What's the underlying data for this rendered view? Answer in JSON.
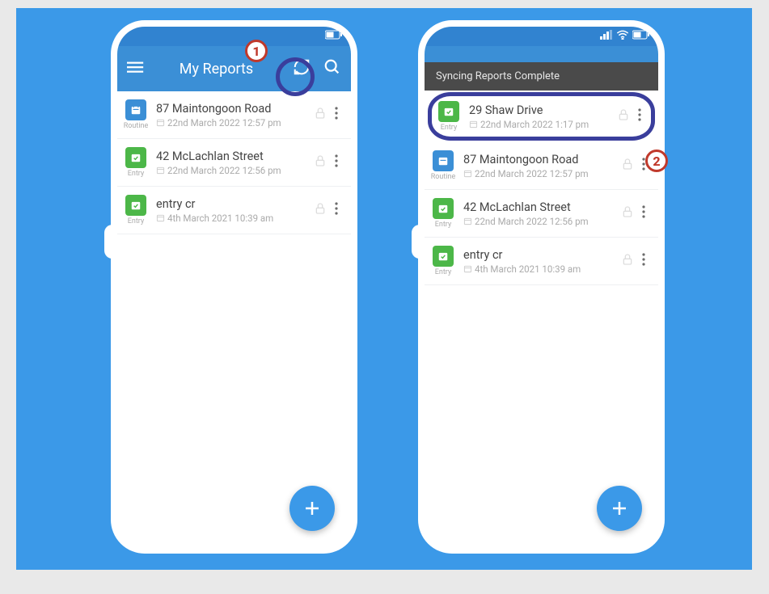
{
  "markers": {
    "one": "1",
    "two": "2"
  },
  "phoneLeft": {
    "appbar": {
      "title": "My Reports"
    },
    "rows": [
      {
        "iconColor": "blue",
        "iconLabel": "Routine",
        "title": "87 Maintongoon Road",
        "date": "22nd March 2022 12:57 pm"
      },
      {
        "iconColor": "green",
        "iconLabel": "Entry",
        "title": "42 McLachlan Street",
        "date": "22nd March 2022 12:56 pm"
      },
      {
        "iconColor": "green",
        "iconLabel": "Entry",
        "title": "entry cr",
        "date": "4th March 2021 10:39 am"
      }
    ]
  },
  "phoneRight": {
    "toast": "Syncing Reports Complete",
    "rows": [
      {
        "iconColor": "green",
        "iconLabel": "Entry",
        "title": "29 Shaw Drive",
        "date": "22nd March 2022 1:17 pm",
        "highlight": true
      },
      {
        "iconColor": "blue",
        "iconLabel": "Routine",
        "title": "87 Maintongoon Road",
        "date": "22nd March 2022 12:57 pm"
      },
      {
        "iconColor": "green",
        "iconLabel": "Entry",
        "title": "42 McLachlan Street",
        "date": "22nd March 2022 12:56 pm"
      },
      {
        "iconColor": "green",
        "iconLabel": "Entry",
        "title": "entry cr",
        "date": "4th March 2021 10:39 am"
      }
    ]
  }
}
